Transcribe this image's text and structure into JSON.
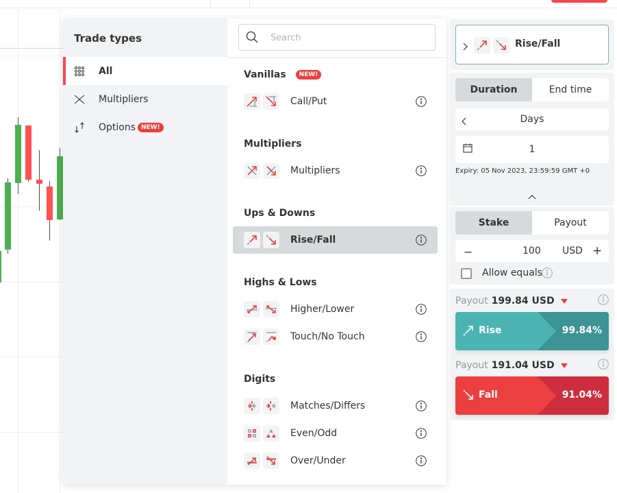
{
  "colors": {
    "brand_red": "#ff444f",
    "rise": "#4bb4b3",
    "rise_dark": "#3d9494",
    "fall": "#ec3f3f",
    "fall_dark": "#cc2e3d",
    "candle_up": "#4caf50",
    "candle_down": "#ff5252"
  },
  "trade_types": {
    "title": "Trade types",
    "sidebar": [
      {
        "label": "All",
        "icon": "grid-icon",
        "active": true
      },
      {
        "label": "Multipliers",
        "icon": "multipliers-icon",
        "active": false
      },
      {
        "label": "Options",
        "icon": "options-icon",
        "active": false,
        "badge": "NEW!"
      }
    ],
    "search": {
      "placeholder": "Search",
      "value": ""
    },
    "categories": [
      {
        "title": "Vanillas",
        "badge": "NEW!",
        "items": [
          {
            "label": "Call/Put",
            "icons": [
              "call-icon",
              "put-icon"
            ]
          }
        ]
      },
      {
        "title": "Multipliers",
        "items": [
          {
            "label": "Multipliers",
            "icons": [
              "multiplier-up-icon",
              "multiplier-down-icon"
            ]
          }
        ]
      },
      {
        "title": "Ups & Downs",
        "items": [
          {
            "label": "Rise/Fall",
            "icons": [
              "rise-icon",
              "fall-icon"
            ],
            "selected": true
          }
        ]
      },
      {
        "title": "Highs & Lows",
        "items": [
          {
            "label": "Higher/Lower",
            "icons": [
              "higher-icon",
              "lower-icon"
            ]
          },
          {
            "label": "Touch/No Touch",
            "icons": [
              "touch-icon",
              "no-touch-icon"
            ]
          }
        ]
      },
      {
        "title": "Digits",
        "items": [
          {
            "label": "Matches/Differs",
            "icons": [
              "matches-icon",
              "differs-icon"
            ]
          },
          {
            "label": "Even/Odd",
            "icons": [
              "even-icon",
              "odd-icon"
            ]
          },
          {
            "label": "Over/Under",
            "icons": [
              "over-icon",
              "under-icon"
            ]
          }
        ]
      }
    ]
  },
  "trade_params": {
    "contract_type": "Rise/Fall",
    "duration_toggle": [
      "Duration",
      "End time"
    ],
    "duration_unit": "Days",
    "duration_value": "1",
    "expiry": "Expiry: 05 Nov 2023, 23:59:59 GMT +0",
    "stake_toggle": [
      "Stake",
      "Payout"
    ],
    "stake_value": "100",
    "currency": "USD",
    "allow_equals_label": "Allow equals",
    "allow_equals_checked": false,
    "rise": {
      "payout_label": "Payout",
      "payout_value": "199.84 USD",
      "button_label": "Rise",
      "percent": "99.84%"
    },
    "fall": {
      "payout_label": "Payout",
      "payout_value": "191.04 USD",
      "button_label": "Fall",
      "percent": "91.04%"
    }
  }
}
